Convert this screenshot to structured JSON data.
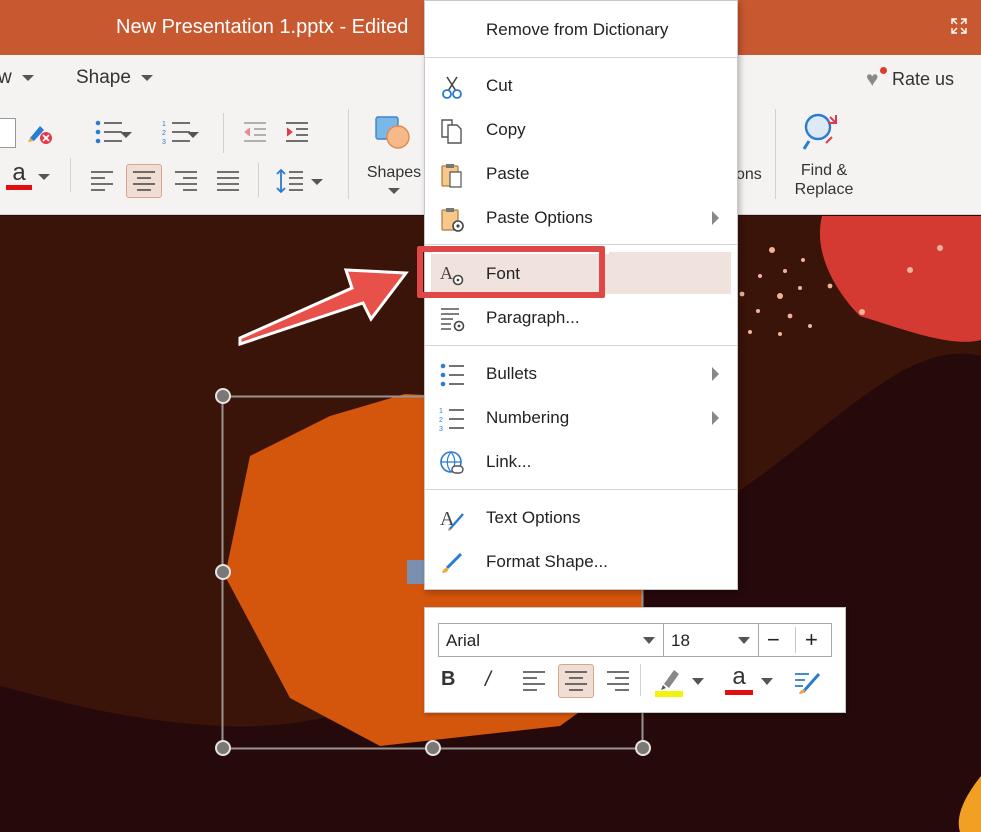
{
  "window": {
    "title": "New Presentation 1.pptx - Edited"
  },
  "ribbon": {
    "tabs": [
      {
        "label": "w"
      },
      {
        "label": "Shape"
      }
    ],
    "rate_us": "Rate us",
    "shapes_label": "Shapes",
    "partial_label": "ons",
    "find_replace_line1": "Find &",
    "find_replace_line2": "Replace",
    "font_color_letter": "a"
  },
  "context_menu": {
    "items": [
      {
        "label": "Remove from Dictionary",
        "icon": "none",
        "submenu": false
      },
      {
        "label": "Cut",
        "icon": "scissors-icon",
        "submenu": false
      },
      {
        "label": "Copy",
        "icon": "copy-icon",
        "submenu": false
      },
      {
        "label": "Paste",
        "icon": "paste-icon",
        "submenu": false
      },
      {
        "label": "Paste Options",
        "icon": "paste-options-icon",
        "submenu": true
      },
      {
        "label": "Font",
        "icon": "font-icon",
        "submenu": false,
        "highlighted": true
      },
      {
        "label": "Paragraph...",
        "icon": "paragraph-icon",
        "submenu": false
      },
      {
        "label": "Bullets",
        "icon": "bullets-icon",
        "submenu": true
      },
      {
        "label": "Numbering",
        "icon": "numbering-icon",
        "submenu": true
      },
      {
        "label": "Link...",
        "icon": "link-icon",
        "submenu": false
      },
      {
        "label": "Text Options",
        "icon": "text-options-icon",
        "submenu": false
      },
      {
        "label": "Format Shape...",
        "icon": "format-shape-icon",
        "submenu": false
      }
    ]
  },
  "mini_toolbar": {
    "font_name": "Arial",
    "font_size": "18",
    "decrease": "−",
    "increase": "+",
    "bold": "B",
    "italic": "/",
    "font_color_letter": "a"
  },
  "colors": {
    "titlebar": "#c8582f",
    "highlight_border": "#e04848",
    "font_color_bar": "#e01010",
    "highlighter": "#f2f20a",
    "slide_background": "#26090a",
    "shape_fill": "#d4560c"
  }
}
